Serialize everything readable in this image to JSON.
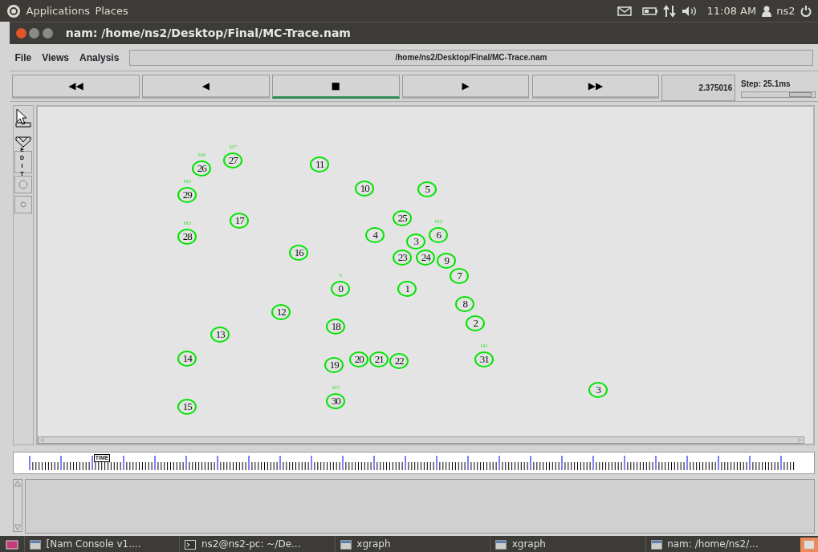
{
  "top_panel": {
    "menus": [
      "Applications",
      "Places"
    ],
    "clock": "11:08 AM",
    "user": "ns2"
  },
  "window": {
    "title": "nam: /home/ns2/Desktop/Final/MC-Trace.nam"
  },
  "menu": [
    "File",
    "Views",
    "Analysis"
  ],
  "file_path": "/home/ns2/Desktop/Final/MC-Trace.nam",
  "playback": [
    {
      "symbol": "◀◀",
      "selected": false
    },
    {
      "symbol": "◀",
      "selected": false
    },
    {
      "symbol": "■",
      "selected": true
    },
    {
      "symbol": "▶",
      "selected": false
    },
    {
      "symbol": "▶▶",
      "selected": false
    }
  ],
  "time": "2.375016",
  "step": {
    "label": "Step: 25.1ms",
    "level": 0.8
  },
  "edit_label": "EDIT",
  "nodes": [
    {
      "label": "26",
      "tag": "M6"
    },
    {
      "label": "27",
      "tag": "M7"
    },
    {
      "label": "11"
    },
    {
      "label": "29",
      "tag": "M4"
    },
    {
      "label": "10"
    },
    {
      "label": "5"
    },
    {
      "label": "17"
    },
    {
      "label": "25"
    },
    {
      "label": "28",
      "tag": "M3"
    },
    {
      "label": "4"
    },
    {
      "label": "3"
    },
    {
      "label": "6",
      "tag": "M2"
    },
    {
      "label": "24"
    },
    {
      "label": "9"
    },
    {
      "label": "16"
    },
    {
      "label": "23"
    },
    {
      "label": "7"
    },
    {
      "label": "0",
      "tag": "S"
    },
    {
      "label": "1"
    },
    {
      "label": "12"
    },
    {
      "label": "8"
    },
    {
      "label": "2"
    },
    {
      "label": "18"
    },
    {
      "label": "13"
    },
    {
      "label": "14"
    },
    {
      "label": "20"
    },
    {
      "label": "21"
    },
    {
      "label": "22"
    },
    {
      "label": "19"
    },
    {
      "label": "31",
      "tag": "M1"
    },
    {
      "label": "3"
    },
    {
      "label": "15"
    },
    {
      "label": "30",
      "tag": "M5"
    }
  ],
  "time_slider": {
    "label": "TIME",
    "level": 0.1
  },
  "taskbar": [
    "[Nam Console v1....",
    "ns2@ns2-pc: ~/De...",
    "xgraph",
    "xgraph",
    "nam: /home/ns2/..."
  ]
}
